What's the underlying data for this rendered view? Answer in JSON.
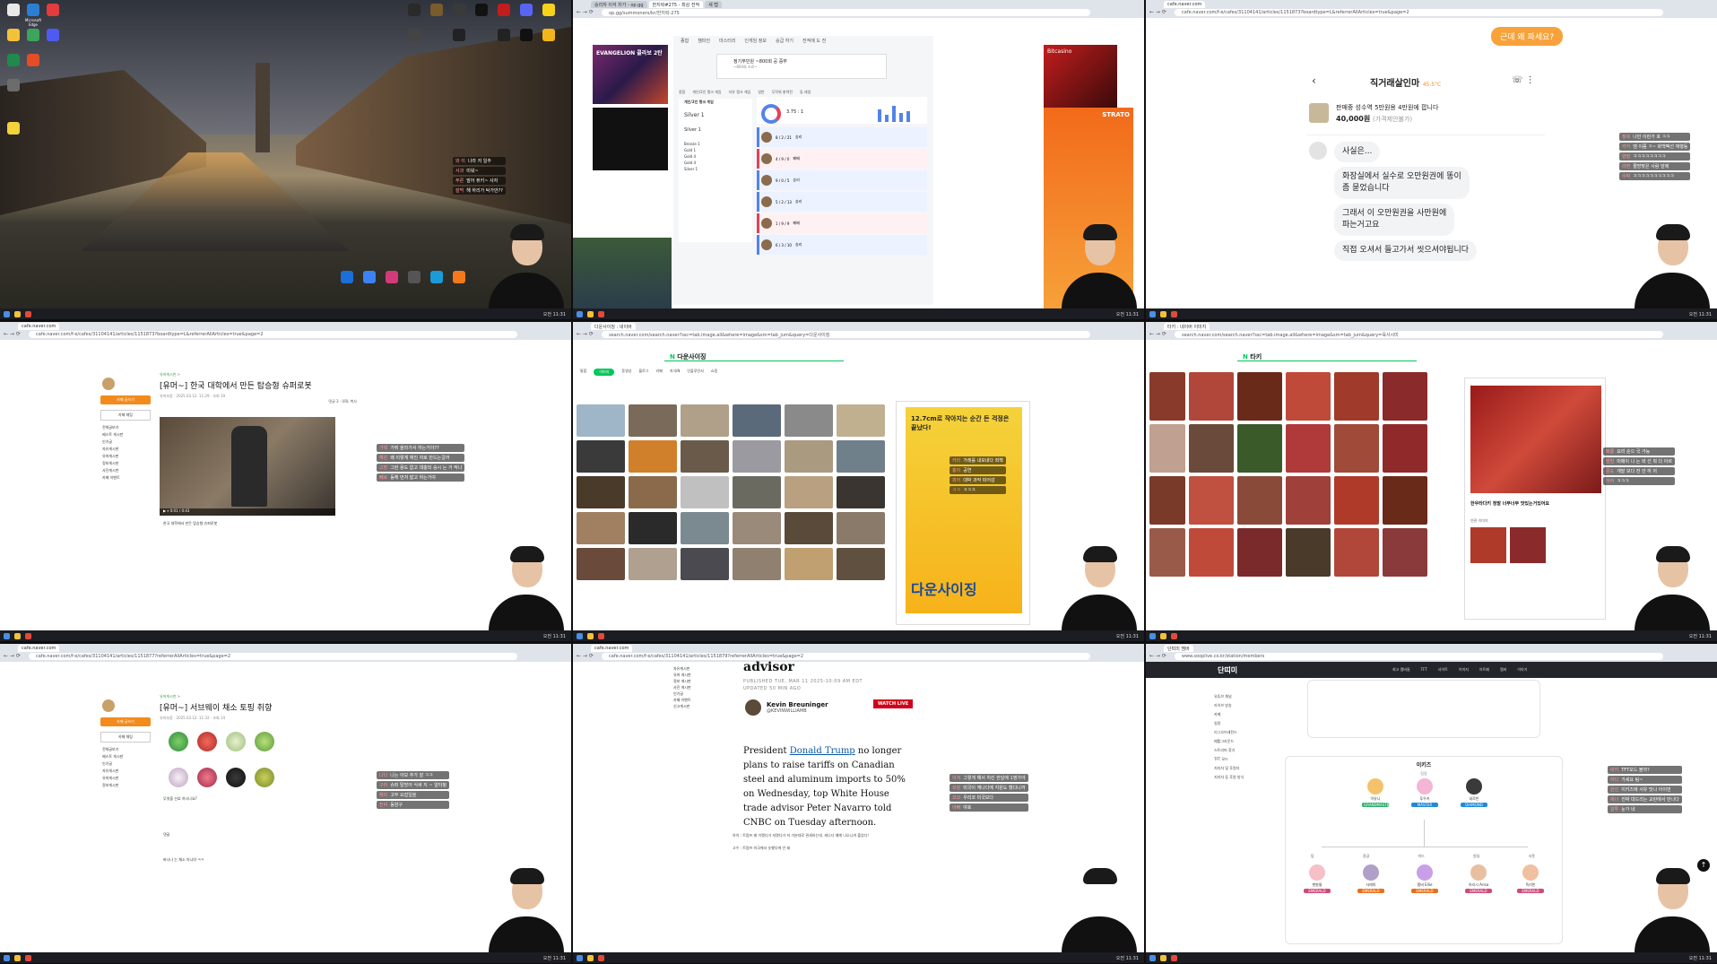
{
  "screens": {
    "desktop": {
      "icons": [
        "Microsoft Edge",
        "OBS",
        "Discord",
        "Steam",
        "Chrome",
        "Battle.net",
        "Riot Client",
        "Kakao"
      ],
      "chat": [
        {
          "user": "와 이",
          "text": "나라 저 일추"
        },
        {
          "user": "사과",
          "text": "미워~"
        },
        {
          "user": "푸른",
          "text": "말어 퓨키~ 사자"
        },
        {
          "user": "잘먹",
          "text": "해 하리가 탁가만??"
        }
      ]
    },
    "opgg": {
      "url": "op.gg/summoners/kr/한지락-275",
      "tabs": [
        "승리자 이석 차가 - op.gg",
        "한지락#275 - 최상 전적",
        "새 탭"
      ],
      "nav": [
        "종합",
        "챔피언",
        "마스터리",
        "인게임 정보",
        "승급 하기",
        "전적에 도 전"
      ],
      "banner_title": "정기부민원 ~800회 공 중쭈",
      "banner_sub": "~800회 조료~",
      "subnav": [
        "종합",
        "개인/2인 랭크 게임",
        "자유 랭크 게임",
        "일반",
        "무작위 총력전",
        "튜 레일"
      ],
      "rank_title": "개인/2인 랭크 게임",
      "tier": "Silver 1",
      "tier2": "Silver 1",
      "rank_rows": [
        "Bronze 1",
        "Gold 1",
        "Gold 4",
        "Gold 4",
        "Silver 1"
      ],
      "kda": "3.75 : 1",
      "ad_left": "EVANGELION 콜라보 2탄",
      "ad_right": "Bitcasino",
      "ad_right2": "STRATO",
      "matches": [
        {
          "score": "8 / 2 / 21",
          "result": "승리"
        },
        {
          "score": "4 / 9 / 0",
          "result": "패배"
        },
        {
          "score": "9 / 0 / 5",
          "result": "승리"
        },
        {
          "score": "5 / 2 / 13",
          "result": "승리"
        },
        {
          "score": "1 / 9 / 9",
          "result": "패배"
        },
        {
          "score": "6 / 3 / 10",
          "result": "승리"
        }
      ]
    },
    "chat_app": {
      "url": "cafe.naver.com/f-e/cafes/31104141/articles/1151873?boardtype=L&referrerAllArticles=true&page=2",
      "bubble_top": "근데 왜 파세요?",
      "seller": "직거래살인마",
      "temp": "45.5°C",
      "item_title": "판매중 성수역 5만원용 4만원에 팝니다",
      "price": "40,000원",
      "price_note": "(가격제안불가)",
      "messages": [
        "사실은...",
        "화장실에서 실수로 오만원권에 똥이\n좀 묻었습니다",
        "그래서 이 오만원권을 사만원에\n파는거고요",
        "직접 오셔서 들고가서 씻으셔야됩니다"
      ],
      "chat": [
        {
          "user": "정복",
          "text": "나만 이런가 호 ㅋㅋ"
        },
        {
          "user": "카카",
          "text": "뎀 이쯤 ㅋ~ 화백팩선 재행동"
        },
        {
          "user": "양말",
          "text": "ㅋㅋㅋㅋㅋㅋㅋㅋ"
        },
        {
          "user": "라면",
          "text": "짤방맞은 사람 앞에"
        },
        {
          "user": "수박",
          "text": "ㅋㅋㅋㅋㅋㅋㅋㅋㅋㅋ"
        }
      ]
    },
    "cafe_robot": {
      "url": "cafe.naver.com/f-e/cafes/31104141/articles/1151873?boardtype=L&referrerAllArticles=true&page=2",
      "side_btn": "카페 글쓰기",
      "side_btn2": "카페 채팅",
      "side_links": [
        "전체글보기",
        "베스트 게시판",
        "인기글",
        "자유게시판",
        "유머게시판",
        "정보게시판",
        "사진게시판",
        "카페 이벤트"
      ],
      "category": "유머게시판 >",
      "title": "[유머~] 한국 대학에서 만든 탑승형 슈퍼로봇",
      "meta": "유머부장 · 2025.03.12. 11:29 · 조회 19",
      "comments": "댓글 3",
      "url_btn": "URL 복사",
      "caption": "한국 대학에서 만든 탑승형 슈퍼로봇",
      "video_time": "0:01 / 0:43",
      "chat": [
        {
          "user": "가뤄",
          "text": "가뤼 올라가서 하는거야??"
        },
        {
          "user": "해빈",
          "text": "왜 이렇게 깨진 자로 만드는걸까"
        },
        {
          "user": "고망",
          "text": "그런 용도 없고 대충되 승시 는 거 작나"
        },
        {
          "user": "빼로",
          "text": "동해 먼저 밟고 하는거야"
        }
      ]
    },
    "image_search": {
      "url": "search.naver.com/search.naver?ssc=tab.image.all&where=image&sm=tab_jum&query=다운사이징",
      "brand": "다운사이징",
      "tabs": [
        "통합",
        "이미지",
        "동영상",
        "블로그",
        "카페",
        "지식iN",
        "인플루언서",
        "쇼핑"
      ],
      "active_tab": "이미지",
      "poster_title": "다운사이징",
      "poster_tag": "12.7cm로 작아지는 순간 돈 걱정은 끝났다!",
      "chat": [
        {
          "user": "카리",
          "text": "가래를 내보내다 죄책"
        },
        {
          "user": "홍이",
          "text": "공연"
        },
        {
          "user": "피어",
          "text": "대박 과작 피어감"
        },
        {
          "user": "ㅋㅋ",
          "text": "ㅋㅋㅋ"
        }
      ]
    },
    "food_search": {
      "url": "search.naver.com/search.naver?ssc=tab.image.all&where=image&sm=tab_jum&query=육사시미",
      "brand": "타키",
      "panel_caption": "한우타다키 정말 너무너무 맛있는거있어요",
      "panel_sub": "연관 이미지",
      "chat": [
        {
          "user": "뽀롱",
          "text": "요리 순으 국 가능"
        },
        {
          "user": "밤밤",
          "text": "미매이 나 는 와 선 뭐 다 아르"
        },
        {
          "user": "문도",
          "text": "개발 보다 전 안 하 저"
        },
        {
          "user": "하하",
          "text": "ㅋㅋㅋ"
        }
      ]
    },
    "cafe_fruit": {
      "url": "cafe.naver.com/f-e/cafes/31104141/articles/1151877?referrerAllArticles=true&page=2",
      "category": "유머게시판 >",
      "title": "[유머~] 서브웨이 채소 토핑 취향",
      "meta": "유머부장 · 2025.03.12. 11:32 · 조회 14",
      "caption": "무엇을 선호 하시나요?",
      "comments_label": "댓글",
      "comment1": "바나나 는 채소 아니야 ㅋㅋ",
      "chat": [
        {
          "user": "나다",
          "text": "나는 아보 추가 잘 ㅋㅋ"
        },
        {
          "user": "구라",
          "text": "슈퍼 탈방어 식싸 지 ~ 알터핑"
        },
        {
          "user": "체리",
          "text": "고부 요잡일을"
        },
        {
          "user": "진비",
          "text": "동양구"
        }
      ]
    },
    "cnbc": {
      "url": "cafe.naver.com/f-e/cafes/31104141/articles/1151879?referrerAllArticles=true&page=2",
      "headline": "advisor",
      "published": "PUBLISHED TUE, MAR 11 2025-10:09 AM EDT",
      "updated": "UPDATED 50 MIN AGO",
      "author": "Kevin Breuninger",
      "handle": "@KEVINWILLIAMB",
      "watch_live": "WATCH LIVE",
      "body_prefix": "President ",
      "body_link": "Donald Trump",
      "body_rest": " no longer plans to raise tariffs on Canadian steel and aluminum imports to 50% on Wednesday, top White House trade advisor Peter Navarro told CNBC on Tuesday afternoon.",
      "kor1": "하이 : 트럼프 왜 이랬다가 저랬다가 저 기분대로 관세하는데. 캐나다 얘계 나오니까 풀었다!",
      "kor2": "고수 : 트럼프 미국에서 숏했다에 안 돼",
      "side_items": [
        "자유게시판",
        "유머 게시판",
        "정보 게시판",
        "사진 게시판",
        "인기글",
        "카페 이벤트",
        "신고게시판"
      ],
      "chat": [
        {
          "user": "이겨",
          "text": "그렇게 해서 처킨 한달에 1영가야"
        },
        {
          "user": "쏘삼",
          "text": "미국이 캐나다에 지원도 했다니까"
        },
        {
          "user": "코코",
          "text": "우리코 미국보다"
        },
        {
          "user": "아빠",
          "text": "야호"
        }
      ]
    },
    "org": {
      "url": "www.sooplive.co.kr/station/members",
      "logo": "단띠미",
      "menu": [
        "최고 멤버들",
        "TFT",
        "사이트",
        "이미지",
        "아트페",
        "멤버",
        "이야기"
      ],
      "lnav": [
        "유튜브 채널",
        "라이브 방송",
        "카페",
        "일정",
        "리그오브레전드",
        "배틀그라운드",
        "스트리머 찾기",
        "TFT 모드",
        "지지자 및 후원자",
        "지지자 등 후원 방식"
      ],
      "section_title": "이키즈",
      "leader_label": "팀장",
      "members_top": [
        {
          "name": "이유니",
          "badge": "GRANDMASTER"
        },
        {
          "name": "푸우키",
          "badge": "MASTER"
        },
        {
          "name": "네로빈",
          "badge": "DIAMOND"
        }
      ],
      "roles": [
        "탑",
        "정글",
        "미드",
        "원딜",
        "서폿"
      ],
      "members_bottom": [
        {
          "name": "젠발룽",
          "badge": "EMERALD"
        },
        {
          "name": "사레미",
          "badge": "EMERALD"
        },
        {
          "name": "맴버 Ellie",
          "badge": "EMERALD"
        },
        {
          "name": "아리시 Arisa",
          "badge": "EMERALD"
        },
        {
          "name": "독리빈",
          "badge": "EMERALD"
        }
      ],
      "chat": [
        {
          "user": "비키",
          "text": "TFT모드 볼까?"
        },
        {
          "user": "하다",
          "text": "가세요 팀~"
        },
        {
          "user": "원진",
          "text": "이키즈에 서유 맛나 아이번"
        },
        {
          "user": "애너",
          "text": "진짜 대드리는 교란에서 만나다"
        },
        {
          "user": "알투",
          "text": "눈가 네"
        }
      ]
    },
    "taskbar_time": "오전 11:31"
  }
}
